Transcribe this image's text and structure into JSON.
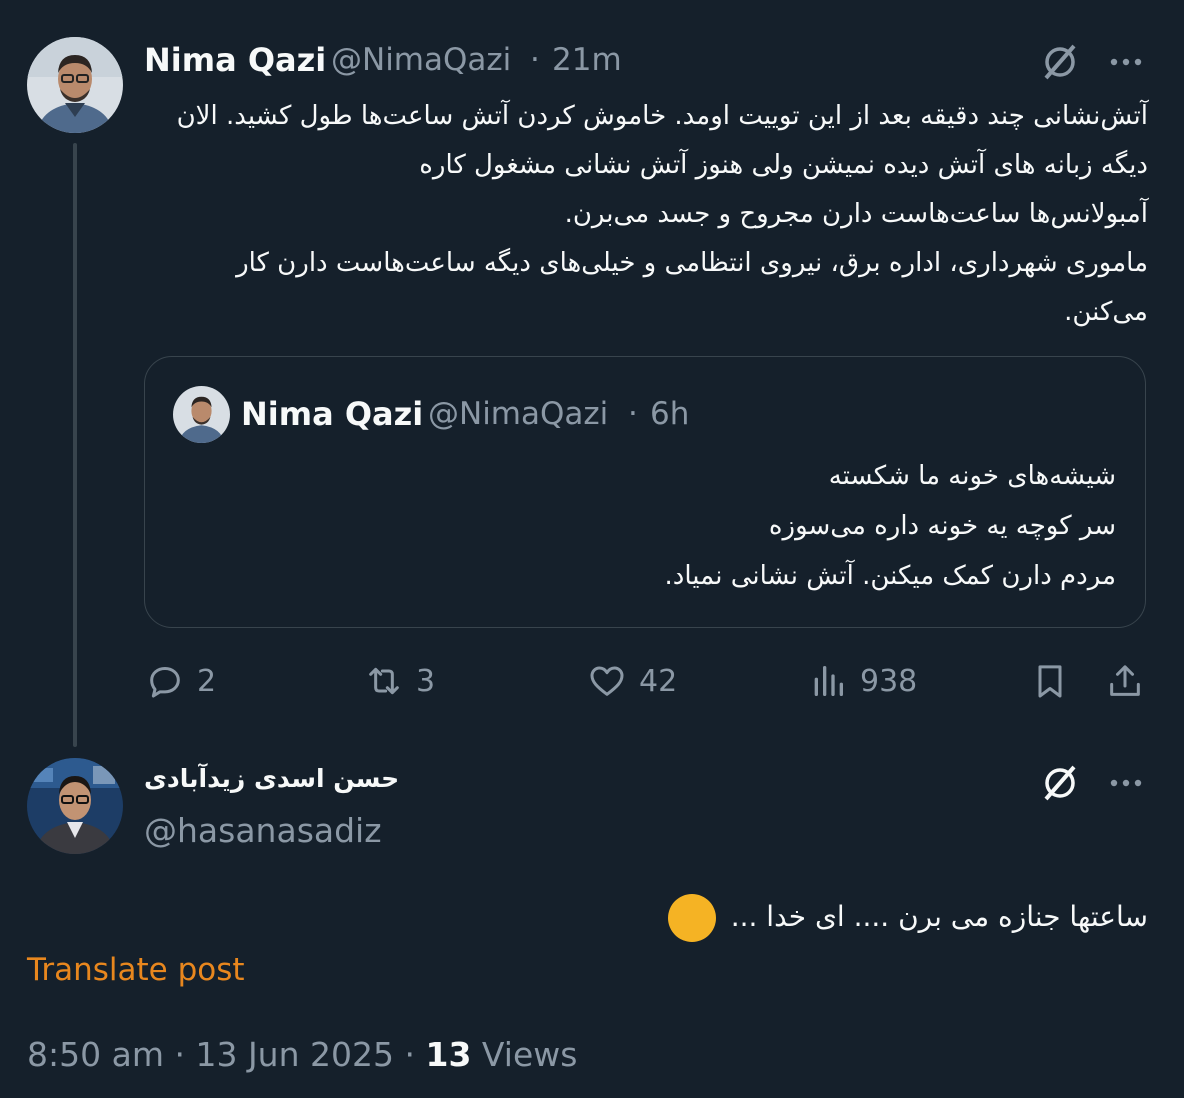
{
  "main_tweet": {
    "display_name": "Nima Qazi",
    "handle": "@NimaQazi",
    "separator": "·",
    "time": "21m",
    "lines": [
      "آتش‌نشانی چند دقیقه بعد از این توییت اومد. خاموش کردن آتش ساعت‌ها طول کشید. الان",
      "دیگه زبانه های آتش دیده نمیشن ولی هنوز آتش نشانی مشغول کاره",
      "آمبولانس‌ها ساعت‌هاست دارن مجروح و جسد می‌برن.",
      "ماموری شهرداری، اداره برق، نیروی انتظامی و خیلی‌های دیگه ساعت‌هاست دارن کار",
      "می‌کنن."
    ]
  },
  "quoted_tweet": {
    "display_name": "Nima Qazi",
    "handle": "@NimaQazi",
    "separator": "·",
    "time": "6h",
    "lines": [
      "شیشه‌های خونه ما شکسته",
      "سر کوچه یه خونه داره می‌سوزه",
      "مردم دارن کمک میکنن. آتش نشانی نمیاد."
    ]
  },
  "actions": {
    "replies": "2",
    "reposts": "3",
    "likes": "42",
    "views": "938"
  },
  "reply_tweet": {
    "display_name": "حسن اسدی زیدآبادی",
    "handle": "@hasanasadiz",
    "text": "ساعتها جنازه می برن .... ای خدا ...",
    "emoji": "😞",
    "translate_label": "Translate post",
    "time": "8:50 am",
    "date": "13 Jun 2025",
    "separator": "·",
    "views_count": "13",
    "views_label": "Views"
  },
  "icons": {
    "grok": "grok-slash-icon",
    "more": "more-dots-icon",
    "reply": "reply-bubble-icon",
    "repost": "repost-icon",
    "like": "heart-icon",
    "views": "views-bars-icon",
    "bookmark": "bookmark-icon",
    "share": "share-icon"
  },
  "colors": {
    "background": "#15202b",
    "text": "#f7f9f9",
    "muted": "#8b98a5",
    "border": "#38444d",
    "translate": "#e8871e"
  }
}
